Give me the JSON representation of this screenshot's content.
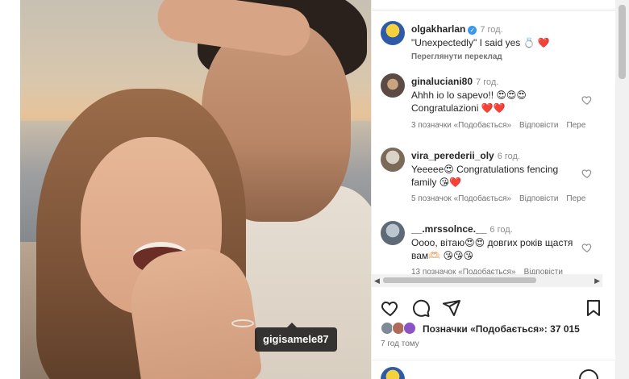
{
  "photo": {
    "tag_username": "gigisamele87"
  },
  "caption": {
    "username": "olgakharlan",
    "verified": true,
    "time": "7 год.",
    "text": "\"Unexpectedly\" I said yes 💍 ❤️",
    "translate": "Переглянути переклад"
  },
  "comments": [
    {
      "username": "ginaluciani80",
      "time": "7 год.",
      "text": "Ahhh io lo sapevo!! 😍😍😍 Congratulazioni ❤️❤️",
      "likes": "3 позначки «Подобається»",
      "reply": "Відповісти",
      "more": "Пере"
    },
    {
      "username": "vira_perederii_oly",
      "time": "6 год.",
      "text": "Yeeeee😍 Congratulations fencing family 😘❤️",
      "likes": "5 позначок «Подобається»",
      "reply": "Відповісти",
      "more": "Пере"
    },
    {
      "username": "__.mrssolnce.__",
      "time": "6 год.",
      "text": "Оооо, вітаю😍😍 довгих років щастя вам🫶🏻 😘😘😘",
      "likes": "13 позначок «Подобається»",
      "reply": "Відповісти",
      "more": ""
    }
  ],
  "post": {
    "likes_label": "Позначки «Подобається»:",
    "likes_count": "37 015",
    "posted_ago": "7 год тому"
  },
  "icons": {
    "like": "heart-icon",
    "comment": "comment-icon",
    "share": "paper-plane-icon",
    "save": "bookmark-icon",
    "verified": "verified-badge-icon"
  },
  "colors": {
    "verified": "#3897f0",
    "heart": "#ed1c40",
    "meta": "#737373"
  }
}
